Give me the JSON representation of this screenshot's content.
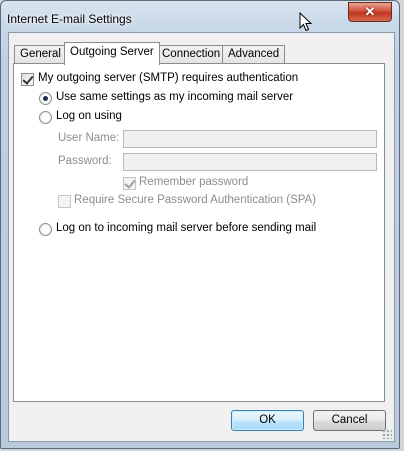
{
  "window": {
    "title": "Internet E-mail Settings",
    "close_glyph": "✕"
  },
  "tabs": [
    {
      "label": "General",
      "active": false
    },
    {
      "label": "Outgoing Server",
      "active": true
    },
    {
      "label": "Connection",
      "active": false
    },
    {
      "label": "Advanced",
      "active": false
    }
  ],
  "outgoing": {
    "requires_auth_label": "My outgoing server (SMTP) requires authentication",
    "requires_auth_checked": true,
    "use_same_label": "Use same settings as my incoming mail server",
    "log_on_using_label": "Log on using",
    "username_label": "User Name:",
    "username_value": "",
    "password_label": "Password:",
    "password_value": "",
    "remember_label": "Remember password",
    "remember_checked": true,
    "spa_label": "Require Secure Password Authentication (SPA)",
    "spa_checked": false,
    "log_on_incoming_label": "Log on to incoming mail server before sending mail",
    "selected_option": "use_same"
  },
  "buttons": {
    "ok": "OK",
    "cancel": "Cancel"
  }
}
